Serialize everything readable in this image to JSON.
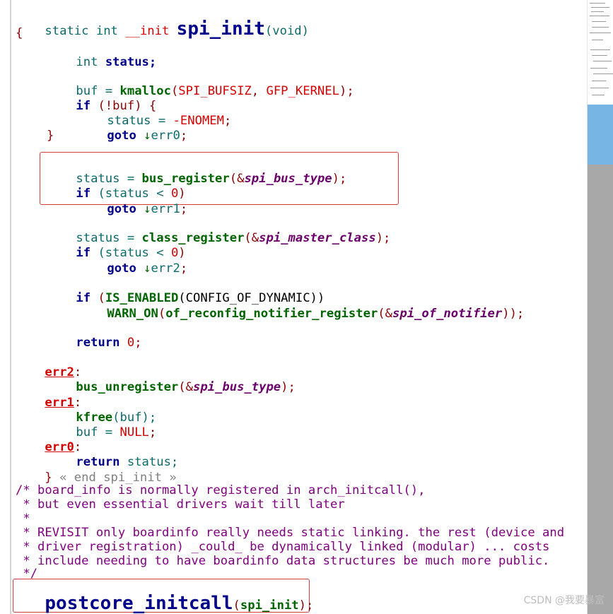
{
  "code": {
    "l01": {
      "a": "static int ",
      "b": "__init ",
      "c": "spi_init",
      "d": "(void)"
    },
    "l02": "{",
    "l03": {
      "a": "int ",
      "b": "status;"
    },
    "l05": {
      "a": "buf = ",
      "b": "kmalloc",
      "c": "(",
      "d": "SPI_BUFSIZ",
      "e": ", ",
      "f": "GFP_KERNEL",
      "g": ");"
    },
    "l06": {
      "a": "if ",
      "b": "(!buf) {"
    },
    "l07": {
      "a": "status = ",
      "b": "-ENOMEM",
      "c": ";"
    },
    "l08": {
      "a": "goto ",
      "b": "↓",
      "c": "err0",
      "d": ";"
    },
    "l09": "}",
    "l11": {
      "a": "status = ",
      "b": "bus_register",
      "c": "(&",
      "d": "spi_bus_type",
      "e": ");"
    },
    "l12": {
      "a": "if ",
      "b": "(status < ",
      "c": "0",
      "d": ")"
    },
    "l13": {
      "a": "goto ",
      "b": "↓",
      "c": "err1",
      "d": ";"
    },
    "l15": {
      "a": "status = ",
      "b": "class_register",
      "c": "(&",
      "d": "spi_master_class",
      "e": ");"
    },
    "l16": {
      "a": "if ",
      "b": "(status < ",
      "c": "0",
      "d": ")"
    },
    "l17": {
      "a": "goto ",
      "b": "↓",
      "c": "err2",
      "d": ";"
    },
    "l19": {
      "a": "if ",
      "b": "(",
      "c": "IS_ENABLED",
      "d": "(CONFIG_OF_DYNAMIC))"
    },
    "l20": {
      "a": "WARN_ON",
      "b": "(",
      "c": "of_reconfig_notifier_register",
      "d": "(&",
      "e": "spi_of_notifier",
      "f": "));"
    },
    "l22": {
      "a": "return ",
      "b": "0",
      "c": ";"
    },
    "l24": {
      "a": "err2",
      "b": ":"
    },
    "l25": {
      "a": "bus_unregister",
      "b": "(&",
      "c": "spi_bus_type",
      "d": ");"
    },
    "l26": {
      "a": "err1",
      "b": ":"
    },
    "l27": {
      "a": "kfree",
      "b": "(buf);"
    },
    "l28": {
      "a": "buf = ",
      "b": "NULL",
      "c": ";"
    },
    "l29": {
      "a": "err0",
      "b": ":"
    },
    "l30": {
      "a": "return ",
      "b": "status;"
    },
    "l31": {
      "a": "} ",
      "b": "« end spi_init »"
    },
    "c1": "/* board_info is normally registered in arch_initcall(),",
    "c2": " * but even essential drivers wait till later",
    "c3": " *",
    "c4": " * REVISIT only boardinfo really needs static linking. the rest (device and",
    "c5": " * driver registration) _could_ be dynamically linked (modular) ... costs",
    "c6": " * include needing to have boardinfo data structures be much more public.",
    "c7": " */",
    "last": {
      "a": "postcore_initcall",
      "b": "(",
      "c": "spi_init",
      "d": ");"
    }
  },
  "watermark": "CSDN @我要暴富"
}
